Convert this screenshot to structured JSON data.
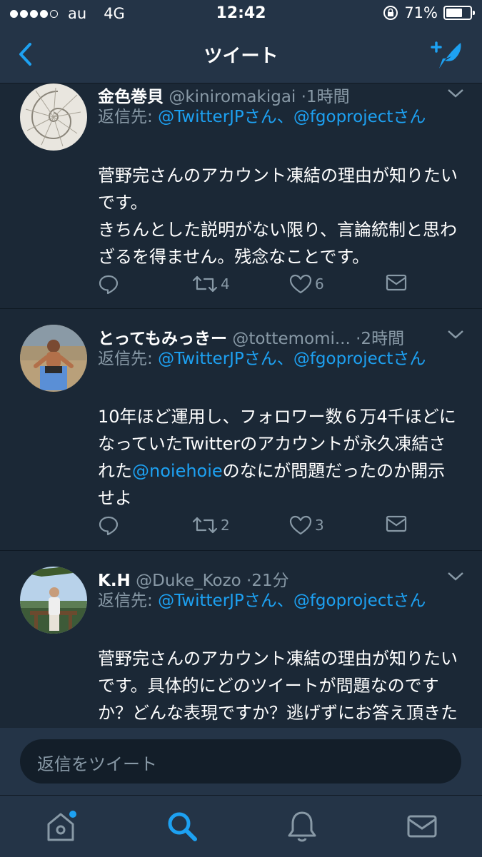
{
  "status_bar": {
    "carrier": "au",
    "network": "4G",
    "time": "12:42",
    "battery": "71%",
    "battery_level": 0.71
  },
  "nav": {
    "title": "ツイート",
    "back_icon": "chevron-left-icon",
    "compose_icon": "compose-tweet-icon"
  },
  "tweets": [
    {
      "name": "金色巻貝",
      "handle": "@kiniromakigai",
      "time": "·1時間",
      "reply_prefix": "返信先: ",
      "reply_to_1": "@TwitterJPさん",
      "reply_sep": "、",
      "reply_to_2": "@fgoprojectさん",
      "text": "菅野完さんのアカウント凍結の理由が知りたいです。\nきちんとした説明がない限り、言論統制と思わざるを得ません。残念なことです。",
      "retweets": "4",
      "likes": "6"
    },
    {
      "name": "とってもみっきー",
      "handle": "@tottemomi...",
      "time": "·2時間",
      "reply_prefix": "返信先: ",
      "reply_to_1": "@TwitterJPさん",
      "reply_sep": "、",
      "reply_to_2": "@fgoprojectさん",
      "text_before": "10年ほど運用し、フォロワー数６万4千ほどになっていたTwitterのアカウントが永久凍結された",
      "mention": "@noiehoie",
      "text_after": "のなにが問題だったのか開示せよ",
      "retweets": "2",
      "likes": "3"
    },
    {
      "name": "K.H",
      "handle": "@Duke_Kozo",
      "time": "·21分",
      "reply_prefix": "返信先: ",
      "reply_to_1": "@TwitterJPさん",
      "reply_sep": "、",
      "reply_to_2": "@fgoprojectさん",
      "text": "菅野完さんのアカウント凍結の理由が知りたいです。具体的にどのツイートが問題なのですか？どんな表現ですか？逃げずにお答え頂きたい"
    }
  ],
  "reply_box": {
    "placeholder": "返信をツイート"
  },
  "tabs": [
    {
      "icon": "home-icon",
      "has_badge": true
    },
    {
      "icon": "search-icon",
      "active": true
    },
    {
      "icon": "notifications-bell-icon"
    },
    {
      "icon": "messages-envelope-icon"
    }
  ],
  "colors": {
    "background": "#1b2836",
    "bar": "#243447",
    "accent": "#1da1f2",
    "secondary_text": "#8899a6"
  }
}
